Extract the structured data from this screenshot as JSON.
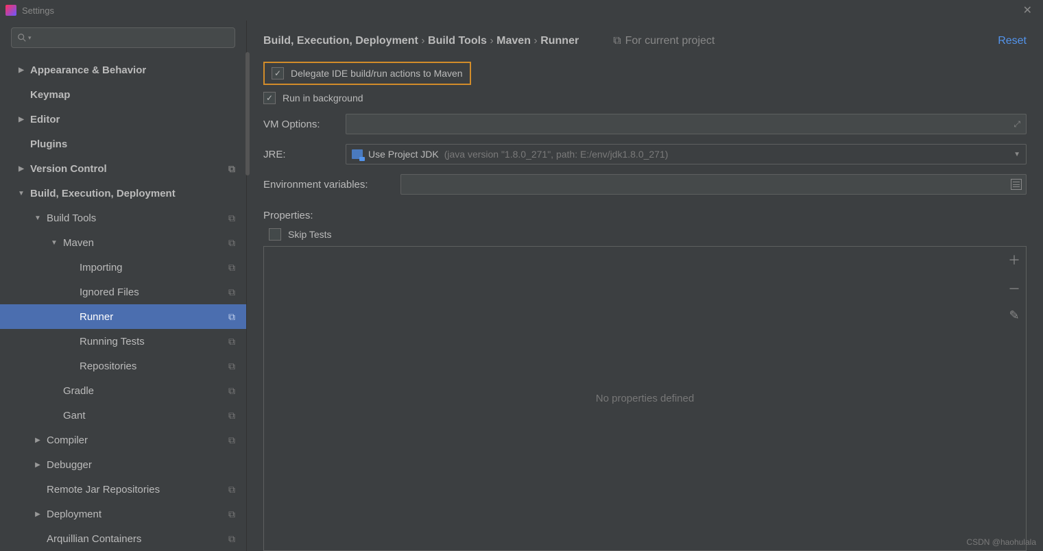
{
  "title": "Settings",
  "breadcrumb": [
    "Build, Execution, Deployment",
    "Build Tools",
    "Maven",
    "Runner"
  ],
  "forProject": "For current project",
  "reset": "Reset",
  "checkboxes": {
    "delegate": "Delegate IDE build/run actions to Maven",
    "runBackground": "Run in background",
    "skipTests": "Skip Tests"
  },
  "labels": {
    "vmOptions": "VM Options:",
    "jre": "JRE:",
    "envVars": "Environment variables:",
    "properties": "Properties:"
  },
  "jre": {
    "main": "Use Project JDK",
    "hint": "(java version \"1.8.0_271\", path: E:/env/jdk1.8.0_271)"
  },
  "propPlaceholder": "No properties defined",
  "watermark": "CSDN @haohulala",
  "tree": [
    {
      "label": "Appearance & Behavior",
      "depth": 0,
      "caret": "▶",
      "bold": true
    },
    {
      "label": "Keymap",
      "depth": 0,
      "caret": "",
      "bold": true
    },
    {
      "label": "Editor",
      "depth": 0,
      "caret": "▶",
      "bold": true
    },
    {
      "label": "Plugins",
      "depth": 0,
      "caret": "",
      "bold": true
    },
    {
      "label": "Version Control",
      "depth": 0,
      "caret": "▶",
      "bold": true,
      "copy": true
    },
    {
      "label": "Build, Execution, Deployment",
      "depth": 0,
      "caret": "▼",
      "bold": true
    },
    {
      "label": "Build Tools",
      "depth": 1,
      "caret": "▼",
      "bold": false,
      "copy": true
    },
    {
      "label": "Maven",
      "depth": 2,
      "caret": "▼",
      "bold": false,
      "copy": true
    },
    {
      "label": "Importing",
      "depth": 3,
      "caret": "",
      "bold": false,
      "copy": true
    },
    {
      "label": "Ignored Files",
      "depth": 3,
      "caret": "",
      "bold": false,
      "copy": true
    },
    {
      "label": "Runner",
      "depth": 3,
      "caret": "",
      "bold": false,
      "copy": true,
      "selected": true
    },
    {
      "label": "Running Tests",
      "depth": 3,
      "caret": "",
      "bold": false,
      "copy": true
    },
    {
      "label": "Repositories",
      "depth": 3,
      "caret": "",
      "bold": false,
      "copy": true
    },
    {
      "label": "Gradle",
      "depth": 2,
      "caret": "",
      "bold": false,
      "copy": true
    },
    {
      "label": "Gant",
      "depth": 2,
      "caret": "",
      "bold": false,
      "copy": true
    },
    {
      "label": "Compiler",
      "depth": 1,
      "caret": "▶",
      "bold": false,
      "copy": true
    },
    {
      "label": "Debugger",
      "depth": 1,
      "caret": "▶",
      "bold": false
    },
    {
      "label": "Remote Jar Repositories",
      "depth": 1,
      "caret": "",
      "bold": false,
      "copy": true
    },
    {
      "label": "Deployment",
      "depth": 1,
      "caret": "▶",
      "bold": false,
      "copy": true
    },
    {
      "label": "Arquillian Containers",
      "depth": 1,
      "caret": "",
      "bold": false,
      "copy": true
    }
  ]
}
